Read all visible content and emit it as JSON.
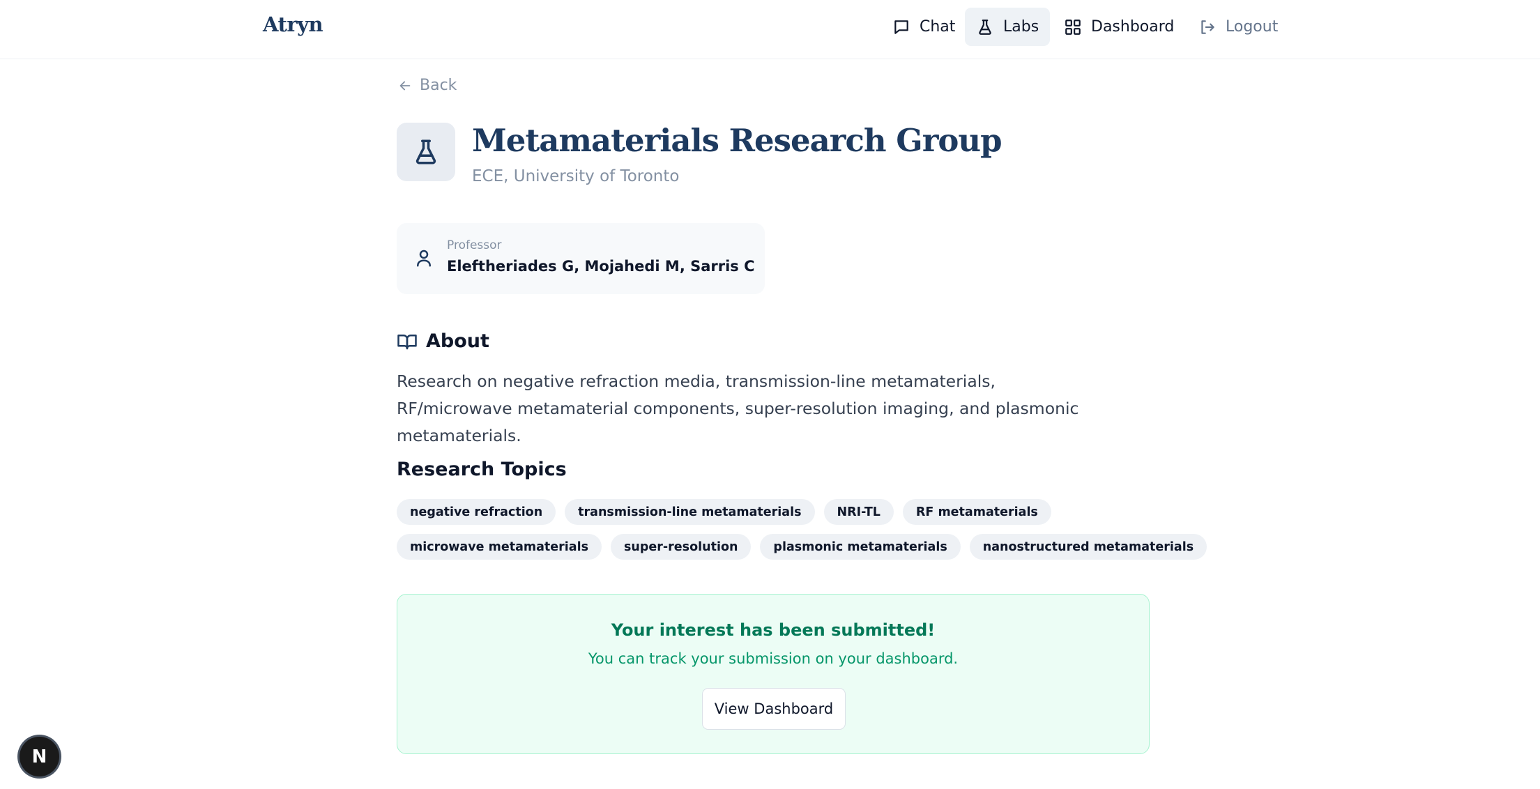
{
  "app": {
    "logo": "Atryn"
  },
  "nav": {
    "items": [
      {
        "label": "Chat",
        "icon": "chat-icon",
        "active": false
      },
      {
        "label": "Labs",
        "icon": "flask-icon",
        "active": true
      },
      {
        "label": "Dashboard",
        "icon": "dashboard-grid-icon",
        "active": false
      },
      {
        "label": "Logout",
        "icon": "logout-icon",
        "active": false
      }
    ]
  },
  "back": {
    "label": "Back"
  },
  "lab": {
    "title": "Metamaterials Research Group",
    "subtitle": "ECE, University of Toronto",
    "professor_label": "Professor",
    "professor": "Eleftheriades G, Mojahedi M, Sarris C"
  },
  "about": {
    "heading": "About",
    "text": "Research on negative refraction media, transmission-line metamaterials, RF/microwave metamaterial components, super-resolution imaging, and plasmonic metamaterials."
  },
  "topics": {
    "heading": "Research Topics",
    "rows": [
      [
        "negative refraction",
        "transmission-line metamaterials",
        "NRI-TL",
        "RF metamaterials"
      ],
      [
        "microwave metamaterials",
        "super-resolution",
        "plasmonic metamaterials",
        "nanostructured metamaterials"
      ]
    ]
  },
  "submission": {
    "title": "Your interest has been submitted!",
    "text": "You can track your submission on your dashboard.",
    "button": "View Dashboard"
  },
  "dev_badge": {
    "label": "N"
  },
  "colors": {
    "brand": "#1e3a5f",
    "success_bg": "#ecfdf5",
    "success_text": "#047857",
    "chip_bg": "#eef1f5"
  }
}
